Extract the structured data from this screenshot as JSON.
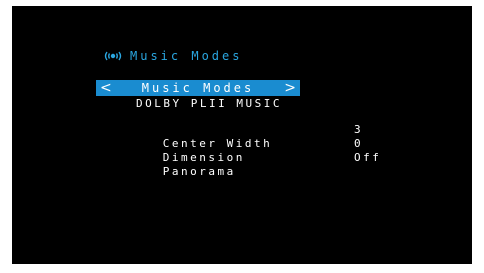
{
  "header": {
    "title": "Music Modes",
    "icon": "speaker-waves-icon"
  },
  "selector": {
    "left_arrow": "<",
    "label": "Music Modes",
    "right_arrow": ">",
    "current_mode": "DOLBY PLII MUSIC"
  },
  "settings": [
    {
      "label": "Center Width",
      "value": "3"
    },
    {
      "label": "Dimension",
      "value": "0"
    },
    {
      "label": "Panorama",
      "value": "Off"
    }
  ],
  "colors": {
    "background": "#000000",
    "accent": "#2aa6e0",
    "highlight": "#1a8cd0",
    "text": "#ffffff"
  }
}
